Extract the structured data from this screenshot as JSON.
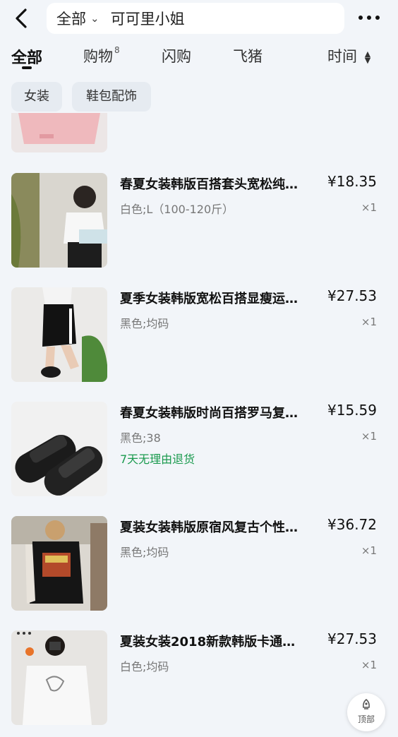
{
  "header": {
    "scope": "全部",
    "query": "可可里小姐"
  },
  "tabs": [
    {
      "label": "全部"
    },
    {
      "label": "购物",
      "count": "8"
    },
    {
      "label": "闪购"
    },
    {
      "label": "飞猪"
    },
    {
      "label": "时间"
    }
  ],
  "filters": [
    "女装",
    "鞋包配饰"
  ],
  "items": [
    {
      "title": "春夏女装韩版百搭套头宽松纯…",
      "price": "¥18.35",
      "variant": "白色;L（100-120斤）",
      "qty": "×1",
      "tag": ""
    },
    {
      "title": "夏季女装韩版宽松百搭显瘦运…",
      "price": "¥27.53",
      "variant": "黑色;均码",
      "qty": "×1",
      "tag": ""
    },
    {
      "title": "春夏女装韩版时尚百搭罗马复…",
      "price": "¥15.59",
      "variant": "黑色;38",
      "qty": "×1",
      "tag": "7天无理由退货"
    },
    {
      "title": "夏装女装韩版原宿风复古个性…",
      "price": "¥36.72",
      "variant": "黑色;均码",
      "qty": "×1",
      "tag": ""
    },
    {
      "title": "夏装女装2018新款韩版卡通…",
      "price": "¥27.53",
      "variant": "白色;均码",
      "qty": "×1",
      "tag": ""
    }
  ],
  "back_to_top": "顶部",
  "colors": {
    "background": "#f2f5f9",
    "chip_bg": "#e6ebf1",
    "tag_green": "#1a9a4e"
  }
}
